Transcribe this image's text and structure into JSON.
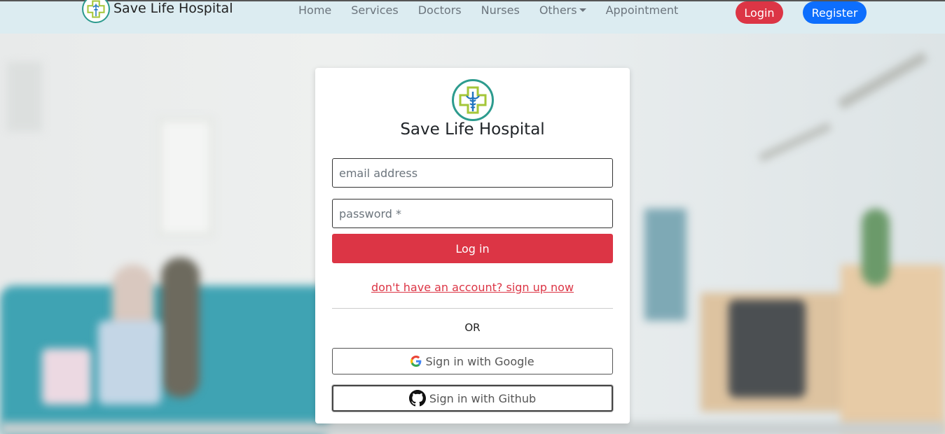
{
  "nav": {
    "brand": "Save Life Hospital",
    "links": [
      "Home",
      "Services",
      "Doctors",
      "Nurses",
      "Others",
      "Appointment"
    ],
    "login_label": "Login",
    "register_label": "Register"
  },
  "login_card": {
    "title": "Save Life Hospital",
    "email_placeholder": "email address",
    "password_placeholder": "password *",
    "login_button": "Log in",
    "signup_link": "don't have an account? sign up now",
    "or_text": "OR",
    "google_button": "Sign in with Google",
    "github_button": "Sign in with Github"
  },
  "icons": {
    "logo": "hospital-cross-caduceus-icon",
    "google": "google-icon",
    "github": "github-icon",
    "dropdown": "caret-down-icon"
  },
  "colors": {
    "accent_red": "#dc3545",
    "accent_blue": "#0d6efd",
    "navbar_bg": "#dcecf1"
  }
}
